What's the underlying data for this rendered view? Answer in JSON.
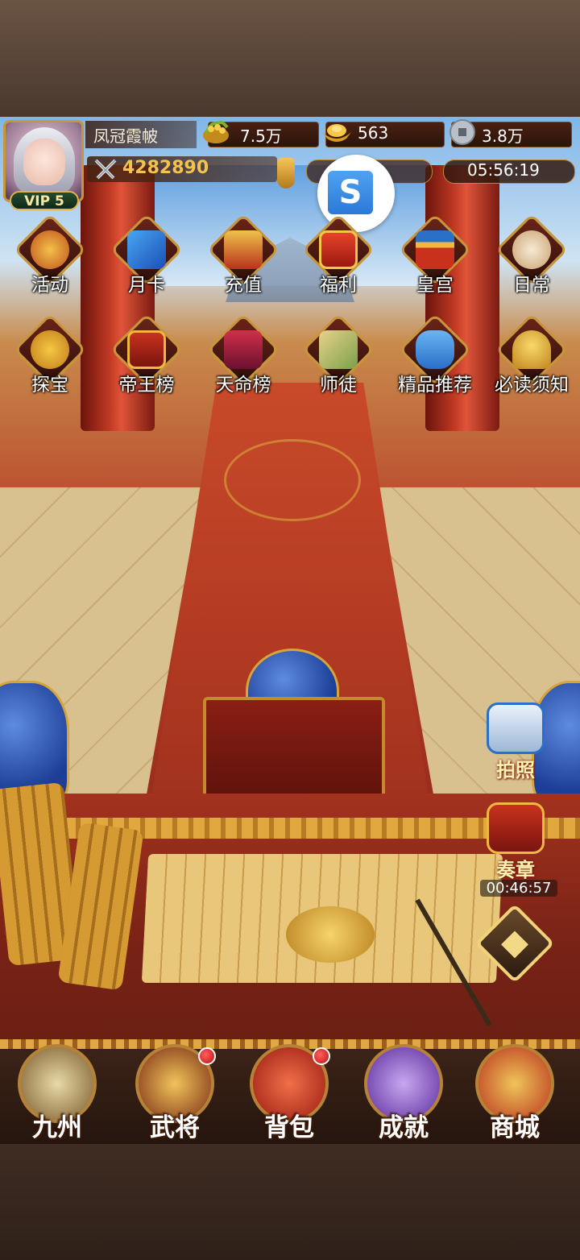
{
  "player": {
    "name": "凤冠霞帔",
    "vip": "VIP 5",
    "power": "4282890"
  },
  "resources": {
    "grain": "7.5万",
    "gold": "563",
    "silver": "3.8万"
  },
  "clock": "05:56:19",
  "floating_button": {
    "label": "S"
  },
  "menu": [
    {
      "label": "活动"
    },
    {
      "label": "月卡"
    },
    {
      "label": "充值"
    },
    {
      "label": "福利"
    },
    {
      "label": "皇宫"
    },
    {
      "label": "日常"
    },
    {
      "label": "探宝"
    },
    {
      "label": "帝王榜"
    },
    {
      "label": "天命榜"
    },
    {
      "label": "师徒"
    },
    {
      "label": "精品推荐"
    },
    {
      "label": "必读须知"
    }
  ],
  "tools": {
    "photo": "拍照",
    "memorial": "奏章",
    "memorial_timer": "00:46:57"
  },
  "nav": [
    {
      "label": "九州"
    },
    {
      "label": "武将"
    },
    {
      "label": "背包"
    },
    {
      "label": "成就"
    },
    {
      "label": "商城"
    }
  ],
  "colors": {
    "accent_gold": "#c7953a",
    "power_text": "#f3c34b",
    "notification_red": "#c0100c"
  }
}
